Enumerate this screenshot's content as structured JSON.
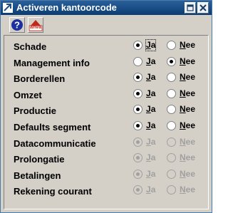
{
  "window": {
    "title": "Activeren kantoorcode",
    "icon": "app-arrow-icon",
    "controls": [
      "restore-icon",
      "close-icon"
    ],
    "colors": {
      "titlebar": "#0b3d73",
      "face": "#d4d0c8"
    }
  },
  "toolbar": {
    "help_icon": "help-question-icon",
    "anva_label": "anva"
  },
  "option_labels": {
    "ja": "Ja",
    "nee": "Nee"
  },
  "rows": [
    {
      "label": "Schade",
      "value": "ja",
      "enabled": true,
      "focused": true
    },
    {
      "label": "Management info",
      "value": "nee",
      "enabled": true
    },
    {
      "label": "Borderellen",
      "value": "ja",
      "enabled": true
    },
    {
      "label": "Omzet",
      "value": "ja",
      "enabled": true
    },
    {
      "label": "Productie",
      "value": "ja",
      "enabled": true
    },
    {
      "label": "Defaults segment",
      "value": "ja",
      "enabled": true
    },
    {
      "label": "Datacommunicatie",
      "value": "ja",
      "enabled": false
    },
    {
      "label": "Prolongatie",
      "value": "ja",
      "enabled": false
    },
    {
      "label": "Betalingen",
      "value": "ja",
      "enabled": false
    },
    {
      "label": "Rekening courant",
      "value": "ja",
      "enabled": false
    }
  ]
}
